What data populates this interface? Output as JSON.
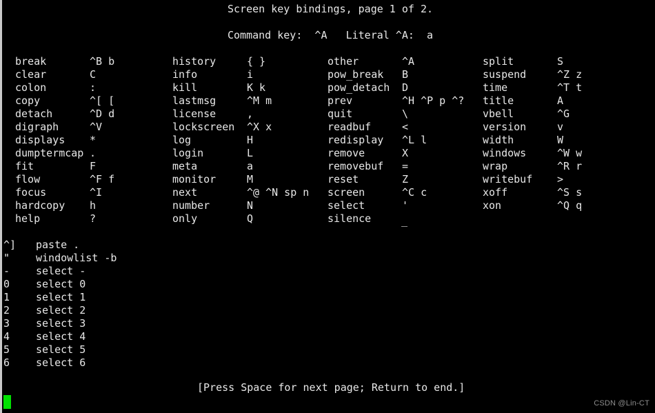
{
  "header": {
    "title": "Screen key bindings, page 1 of 2.",
    "command_key_line": "Command key:  ^A   Literal ^A:  a"
  },
  "colors": {
    "background": "#000000",
    "foreground": "#e8e8e8",
    "cursor": "#00e000",
    "border": "#c9c9c9",
    "watermark": "#8e8e8e"
  },
  "bindings": {
    "columns": [
      {
        "rows": [
          {
            "command": "break",
            "key": "^B b"
          },
          {
            "command": "clear",
            "key": "C"
          },
          {
            "command": "colon",
            "key": ":"
          },
          {
            "command": "copy",
            "key": "^[ ["
          },
          {
            "command": "detach",
            "key": "^D d"
          },
          {
            "command": "digraph",
            "key": "^V"
          },
          {
            "command": "displays",
            "key": "*"
          },
          {
            "command": "dumptermcap",
            "key": "."
          },
          {
            "command": "fit",
            "key": "F"
          },
          {
            "command": "flow",
            "key": "^F f"
          },
          {
            "command": "focus",
            "key": "^I"
          },
          {
            "command": "hardcopy",
            "key": "h"
          },
          {
            "command": "help",
            "key": "?"
          }
        ]
      },
      {
        "rows": [
          {
            "command": "history",
            "key": "{ }"
          },
          {
            "command": "info",
            "key": "i"
          },
          {
            "command": "kill",
            "key": "K k"
          },
          {
            "command": "lastmsg",
            "key": "^M m"
          },
          {
            "command": "license",
            "key": ","
          },
          {
            "command": "lockscreen",
            "key": "^X x"
          },
          {
            "command": "log",
            "key": "H"
          },
          {
            "command": "login",
            "key": "L"
          },
          {
            "command": "meta",
            "key": "a"
          },
          {
            "command": "monitor",
            "key": "M"
          },
          {
            "command": "next",
            "key": "^@ ^N sp n"
          },
          {
            "command": "number",
            "key": "N"
          },
          {
            "command": "only",
            "key": "Q"
          }
        ]
      },
      {
        "rows": [
          {
            "command": "other",
            "key": "^A"
          },
          {
            "command": "pow_break",
            "key": "B"
          },
          {
            "command": "pow_detach",
            "key": "D"
          },
          {
            "command": "prev",
            "key": "^H ^P p ^?"
          },
          {
            "command": "quit",
            "key": "\\"
          },
          {
            "command": "readbuf",
            "key": "<"
          },
          {
            "command": "redisplay",
            "key": "^L l"
          },
          {
            "command": "remove",
            "key": "X"
          },
          {
            "command": "removebuf",
            "key": "="
          },
          {
            "command": "reset",
            "key": "Z"
          },
          {
            "command": "screen",
            "key": "^C c"
          },
          {
            "command": "select",
            "key": "'"
          },
          {
            "command": "silence",
            "key": ""
          }
        ]
      },
      {
        "rows": [
          {
            "command": "split",
            "key": "S"
          },
          {
            "command": "suspend",
            "key": "^Z z"
          },
          {
            "command": "time",
            "key": "^T t"
          },
          {
            "command": "title",
            "key": "A"
          },
          {
            "command": "vbell",
            "key": "^G"
          },
          {
            "command": "version",
            "key": "v"
          },
          {
            "command": "width",
            "key": "W"
          },
          {
            "command": "windows",
            "key": "^W w"
          },
          {
            "command": "wrap",
            "key": "^R r"
          },
          {
            "command": "writebuf",
            "key": ">"
          },
          {
            "command": "xoff",
            "key": "^S s"
          },
          {
            "command": "xon",
            "key": "^Q q"
          },
          {
            "command": "",
            "key": ""
          }
        ]
      }
    ],
    "silence_wrapped_key": "_"
  },
  "extra_bindings": [
    {
      "key": "^]",
      "command": "paste ."
    },
    {
      "key": "\"",
      "command": "windowlist -b"
    },
    {
      "key": "-",
      "command": "select -"
    },
    {
      "key": "0",
      "command": "select 0"
    },
    {
      "key": "1",
      "command": "select 1"
    },
    {
      "key": "2",
      "command": "select 2"
    },
    {
      "key": "3",
      "command": "select 3"
    },
    {
      "key": "4",
      "command": "select 4"
    },
    {
      "key": "5",
      "command": "select 5"
    },
    {
      "key": "6",
      "command": "select 6"
    }
  ],
  "footer": {
    "prompt": "[Press Space for next page; Return to end.]"
  },
  "watermark": {
    "text": "CSDN @Lin-CT"
  }
}
